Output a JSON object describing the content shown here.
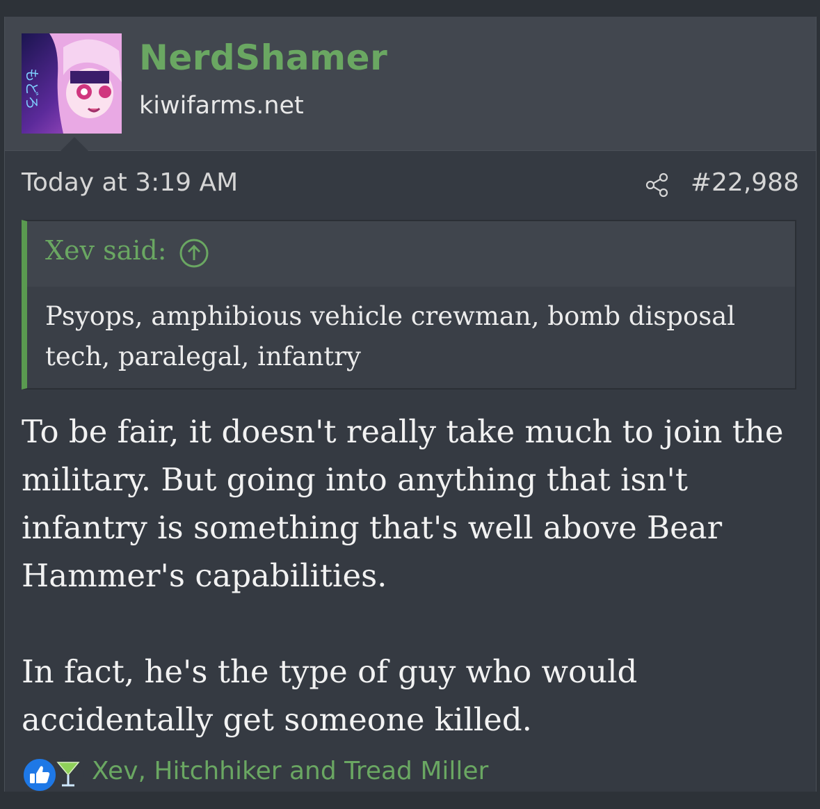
{
  "post": {
    "username": "NerdShamer",
    "user_title": "kiwifarms.net",
    "avatar_icon": "avatar-anime-girl",
    "timestamp": "Today at 3:19 AM",
    "share_icon": "share-icon",
    "post_number": "#22,988",
    "quote": {
      "attribution": "Xev said:",
      "jump_icon": "arrow-up-circle-icon",
      "text": "Psyops, amphibious vehicle crewman, bomb disposal tech, paralegal, infantry"
    },
    "message": {
      "paragraph_1": "To be fair, it doesn't really take much to join the military. But going into anything that isn't infantry is something that's well above Bear Hammer's capabilities.",
      "paragraph_2": "In fact, he's the type of guy who would accidentally get someone killed."
    },
    "reactions": {
      "icons": [
        "thumbs-up-icon",
        "cocktail-icon"
      ],
      "users": "Xev, Hitchhiker and Tread Miller"
    }
  },
  "colors": {
    "username": "#6aa762",
    "accent_green": "#5a9a50",
    "post_bg": "#353a42",
    "user_block_bg": "#42474f",
    "like_blue": "#1e78e6"
  }
}
